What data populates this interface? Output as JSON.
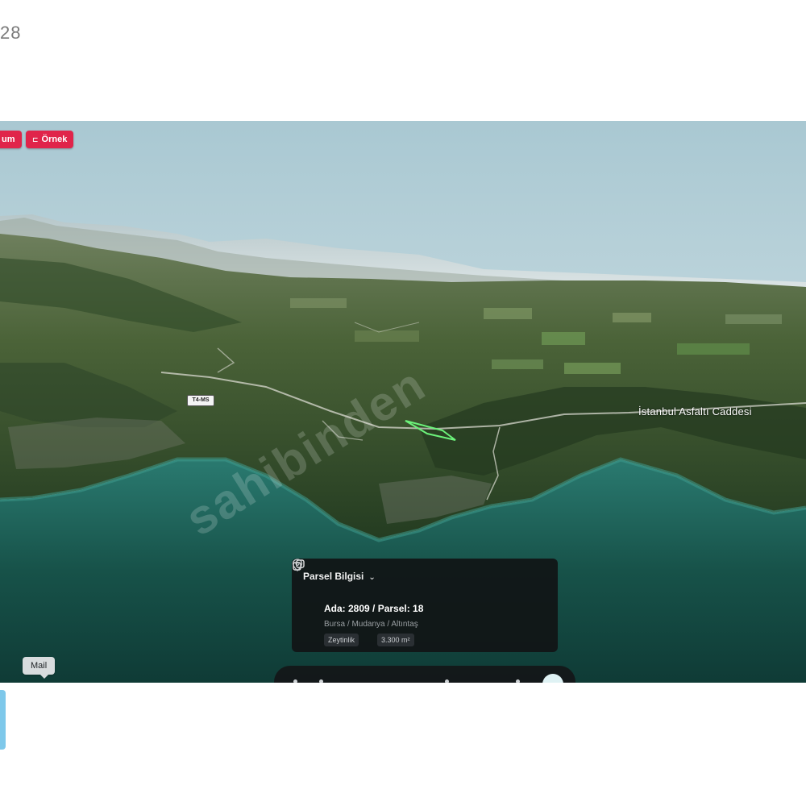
{
  "page_number": "28",
  "badges": {
    "left_label": "um",
    "right_label": "Örnek",
    "right_icon": "play-icon"
  },
  "map": {
    "road_label": "İstanbul Asfaltı Caddesi",
    "shield_label": "T4-MS",
    "watermark": "sahibinden"
  },
  "parcel_card": {
    "title": "Parsel Bilgisi",
    "ada_parsel": "Ada: 2809 / Parsel: 18",
    "location": "Bursa / Mudanya / Altıntaş",
    "tags": [
      "Zeytinlik",
      "3.300 m²"
    ]
  },
  "tooltip": {
    "label": "Mail"
  },
  "colors": {
    "badge": "#e0244a",
    "sea": "#17554f",
    "sky": "#cfe0e6",
    "parcel_outline": "#6cf27a",
    "card_bg": "#111416"
  }
}
